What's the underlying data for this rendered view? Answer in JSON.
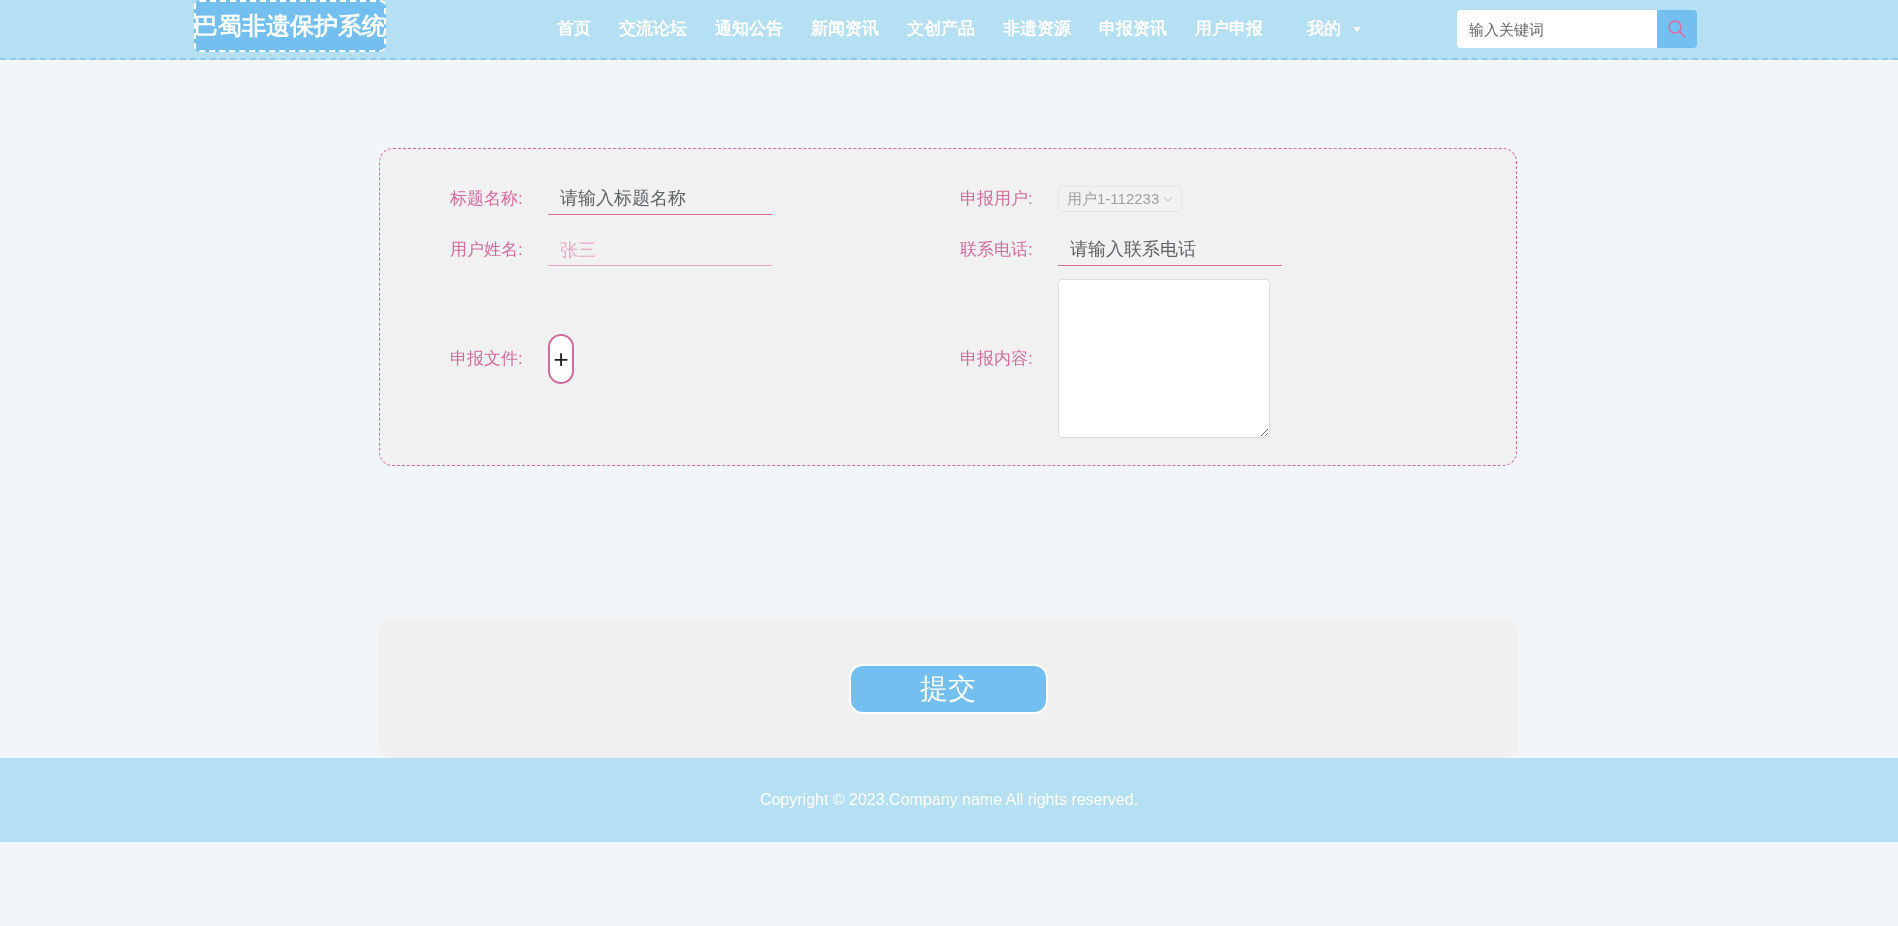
{
  "header": {
    "logo": "巴蜀非遗保护系统",
    "nav": [
      {
        "label": "首页",
        "dropdown": false
      },
      {
        "label": "交流论坛",
        "dropdown": false
      },
      {
        "label": "通知公告",
        "dropdown": false
      },
      {
        "label": "新闻资讯",
        "dropdown": false
      },
      {
        "label": "文创产品",
        "dropdown": false
      },
      {
        "label": "非遗资源",
        "dropdown": false
      },
      {
        "label": "申报资讯",
        "dropdown": false
      },
      {
        "label": "用户申报",
        "dropdown": false
      },
      {
        "label": "我的",
        "dropdown": true
      }
    ],
    "search": {
      "placeholder": "输入关键词"
    }
  },
  "form": {
    "fields": [
      {
        "kind": "input",
        "label": "标题名称:",
        "placeholder": "请输入标题名称",
        "disabled": false
      },
      {
        "kind": "select",
        "label": "申报用户:",
        "value": "用户1-112233",
        "disabled": true
      },
      {
        "kind": "input",
        "label": "用户姓名:",
        "value": "张三",
        "disabled": true
      },
      {
        "kind": "input",
        "label": "联系电话:",
        "placeholder": "请输入联系电话",
        "disabled": false
      },
      {
        "kind": "upload",
        "label": "申报文件:",
        "icon": "+"
      },
      {
        "kind": "textarea",
        "label": "申报内容:"
      }
    ]
  },
  "submit": "提交",
  "footer": "Copyright © 2023.Company name All rights reserved."
}
